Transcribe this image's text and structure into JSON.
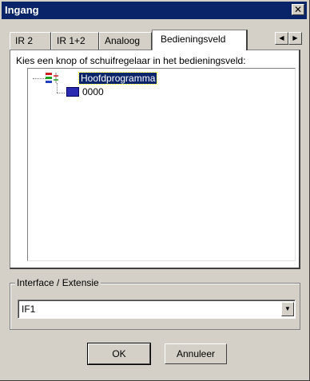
{
  "window": {
    "title": "Ingang",
    "close_glyph": "✕"
  },
  "tabs": [
    {
      "label": "IR 2"
    },
    {
      "label": "IR 1+2"
    },
    {
      "label": "Analoog"
    },
    {
      "label": "Bedieningsveld",
      "active": true
    }
  ],
  "tab_scroll": {
    "left_glyph": "◀",
    "right_glyph": "▶"
  },
  "panel": {
    "instruction": "Kies een knop of schuifregelaar in het bedieningsveld:",
    "tree": {
      "root": {
        "label": "Hoofdprogramma",
        "icon": "program-icon",
        "selected": true
      },
      "children": [
        {
          "label": "0000",
          "icon": "panel-element-icon"
        }
      ]
    }
  },
  "interface_group": {
    "label": "Interface / Extensie",
    "select": {
      "value": "IF1",
      "arrow_glyph": "▼"
    }
  },
  "buttons": {
    "ok": "OK",
    "cancel": "Annuleer"
  },
  "colors": {
    "titlebar": "#0a246a",
    "selection": "#0a246a",
    "face": "#d4d0c8",
    "node_icon": "#2a2ab0"
  }
}
